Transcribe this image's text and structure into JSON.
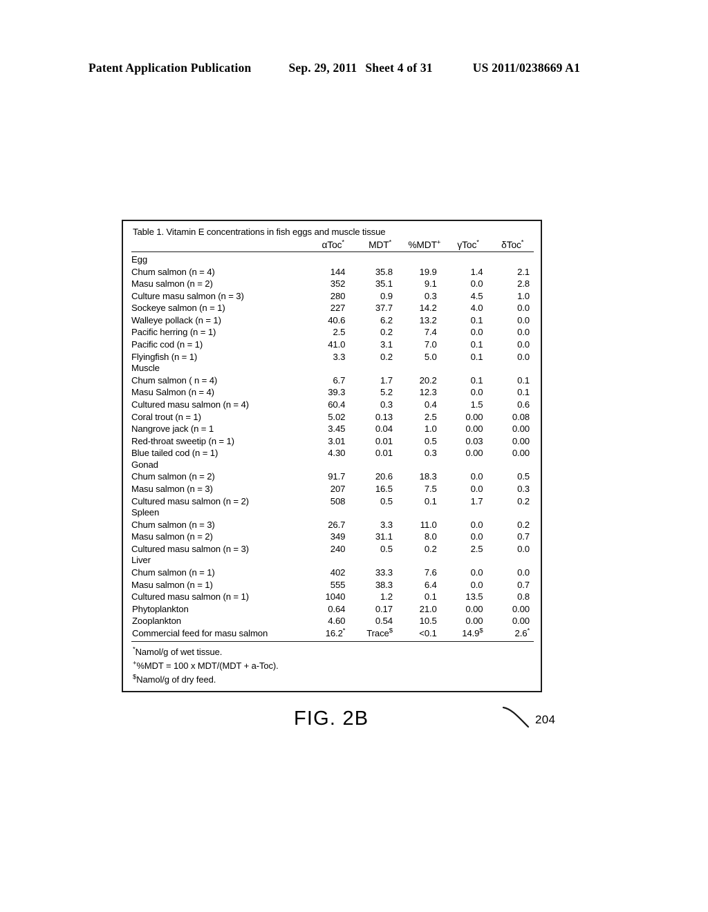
{
  "header": {
    "publication": "Patent Application Publication",
    "date": "Sep. 29, 2011",
    "sheet": "Sheet 4 of 31",
    "patent_number": "US 2011/0238669 A1"
  },
  "figure": {
    "caption": "FIG. 2B",
    "reference_numeral": "204"
  },
  "table": {
    "title": "Table 1.  Vitamin E concentrations in fish eggs and muscle tissue",
    "columns": [
      {
        "label": "",
        "mark": ""
      },
      {
        "label": "αToc",
        "mark": "*"
      },
      {
        "label": "MDT",
        "mark": "*"
      },
      {
        "label": "%MDT",
        "mark": "+"
      },
      {
        "label": "γToc",
        "mark": "*"
      },
      {
        "label": "δToc",
        "mark": "*"
      }
    ],
    "rows": [
      {
        "kind": "group",
        "label": "Egg"
      },
      {
        "kind": "species",
        "label": "Chum salmon (n = 4)",
        "values": [
          "144",
          "35.8",
          "19.9",
          "1.4",
          "2.1"
        ]
      },
      {
        "kind": "species",
        "label": "Masu salmon (n = 2)",
        "values": [
          "352",
          "35.1",
          "9.1",
          "0.0",
          "2.8"
        ]
      },
      {
        "kind": "species",
        "label": "Culture masu salmon (n = 3)",
        "values": [
          "280",
          "0.9",
          "0.3",
          "4.5",
          "1.0"
        ]
      },
      {
        "kind": "species",
        "label": "Sockeye salmon (n = 1)",
        "values": [
          "227",
          "37.7",
          "14.2",
          "4.0",
          "0.0"
        ]
      },
      {
        "kind": "species",
        "label": "Walleye pollack (n = 1)",
        "values": [
          "40.6",
          "6.2",
          "13.2",
          "0.1",
          "0.0"
        ]
      },
      {
        "kind": "species",
        "label": "Pacific herring (n = 1)",
        "values": [
          "2.5",
          "0.2",
          "7.4",
          "0.0",
          "0.0"
        ]
      },
      {
        "kind": "species",
        "label": "Pacific cod (n = 1)",
        "values": [
          "41.0",
          "3.1",
          "7.0",
          "0.1",
          "0.0"
        ]
      },
      {
        "kind": "species",
        "label": "Flyingfish (n = 1)",
        "values": [
          "3.3",
          "0.2",
          "5.0",
          "0.1",
          "0.0"
        ]
      },
      {
        "kind": "group",
        "label": "Muscle"
      },
      {
        "kind": "species",
        "label": "Chum salmon ( n = 4)",
        "values": [
          "6.7",
          "1.7",
          "20.2",
          "0.1",
          "0.1"
        ]
      },
      {
        "kind": "species",
        "label": "Masu Salmon (n = 4)",
        "values": [
          "39.3",
          "5.2",
          "12.3",
          "0.0",
          "0.1"
        ]
      },
      {
        "kind": "species",
        "label": "Cultured masu salmon (n = 4)",
        "values": [
          "60.4",
          "0.3",
          "0.4",
          "1.5",
          "0.6"
        ]
      },
      {
        "kind": "species",
        "label": "Coral trout (n = 1)",
        "values": [
          "5.02",
          "0.13",
          "2.5",
          "0.00",
          "0.08"
        ]
      },
      {
        "kind": "species",
        "label": "Nangrove jack (n = 1",
        "values": [
          "3.45",
          "0.04",
          "1.0",
          "0.00",
          "0.00"
        ]
      },
      {
        "kind": "species",
        "label": "Red-throat sweetip (n = 1)",
        "values": [
          "3.01",
          "0.01",
          "0.5",
          "0.03",
          "0.00"
        ]
      },
      {
        "kind": "species",
        "label": "Blue tailed cod (n = 1)",
        "values": [
          "4.30",
          "0.01",
          "0.3",
          "0.00",
          "0.00"
        ]
      },
      {
        "kind": "group",
        "label": "Gonad"
      },
      {
        "kind": "species",
        "label": "Chum salmon (n = 2)",
        "values": [
          "91.7",
          "20.6",
          "18.3",
          "0.0",
          "0.5"
        ]
      },
      {
        "kind": "species",
        "label": "Masu salmon (n = 3)",
        "values": [
          "207",
          "16.5",
          "7.5",
          "0.0",
          "0.3"
        ]
      },
      {
        "kind": "species",
        "label": "Cultured masu salmon (n = 2)",
        "values": [
          "508",
          "0.5",
          "0.1",
          "1.7",
          "0.2"
        ]
      },
      {
        "kind": "group",
        "label": "Spleen"
      },
      {
        "kind": "species",
        "label": "Chum salmon (n = 3)",
        "values": [
          "26.7",
          "3.3",
          "11.0",
          "0.0",
          "0.2"
        ]
      },
      {
        "kind": "species",
        "label": "Masu salmon (n = 2)",
        "values": [
          "349",
          "31.1",
          "8.0",
          "0.0",
          "0.7"
        ]
      },
      {
        "kind": "species",
        "label": "Cultured masu salmon (n = 3)",
        "values": [
          "240",
          "0.5",
          "0.2",
          "2.5",
          "0.0"
        ]
      },
      {
        "kind": "group",
        "label": "Liver"
      },
      {
        "kind": "species",
        "label": "Chum salmon (n = 1)",
        "values": [
          "402",
          "33.3",
          "7.6",
          "0.0",
          "0.0"
        ]
      },
      {
        "kind": "species",
        "label": "Masu salmon (n = 1)",
        "values": [
          "555",
          "38.3",
          "6.4",
          "0.0",
          "0.7"
        ]
      },
      {
        "kind": "species",
        "label": "Cultured masu salmon (n = 1)",
        "values": [
          "1040",
          "1.2",
          "0.1",
          "13.5",
          "0.8"
        ]
      },
      {
        "kind": "flush",
        "label": "Phytoplankton",
        "values": [
          "0.64",
          "0.17",
          "21.0",
          "0.00",
          "0.00"
        ]
      },
      {
        "kind": "flush",
        "label": "Zooplankton",
        "values": [
          "4.60",
          "0.54",
          "10.5",
          "0.00",
          "0.00"
        ]
      },
      {
        "kind": "flush",
        "label": "Commercial feed for masu salmon",
        "values": [
          "16.2",
          "Trace",
          "<0.1",
          "14.9",
          "2.6"
        ],
        "marks": [
          "*",
          "$",
          "",
          "$",
          "*"
        ],
        "last": true
      }
    ],
    "footnotes": [
      {
        "mark": "*",
        "text": "Namol/g of wet tissue."
      },
      {
        "mark": "+",
        "text": "%MDT = 100 x MDT/(MDT + a-Toc)."
      },
      {
        "mark": "$",
        "text": "Namol/g of dry feed."
      }
    ]
  }
}
